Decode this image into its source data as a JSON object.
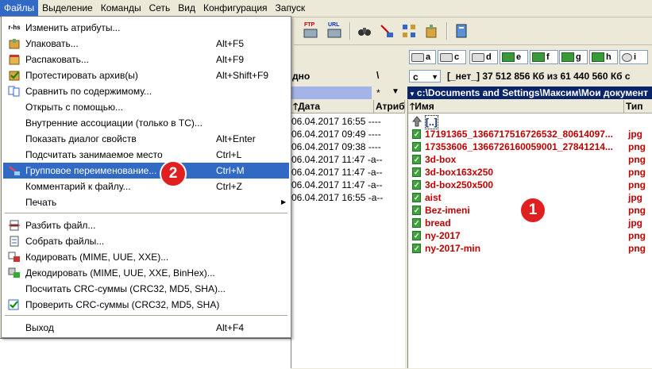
{
  "menubar": {
    "items": [
      "Файлы",
      "Выделение",
      "Команды",
      "Сеть",
      "Вид",
      "Конфигурация",
      "Запуск"
    ]
  },
  "toolbar": {
    "ftp_label": "FTP",
    "url_label": "URL"
  },
  "drives": [
    "a",
    "c",
    "d",
    "e",
    "f",
    "g",
    "h",
    "i"
  ],
  "left_panel": {
    "partial_header": "дно",
    "backslash": "\\",
    "columns": [
      "Дата",
      "Атриб"
    ],
    "rows": [
      {
        "date": "06.04.2017 16:55",
        "attr": "----"
      },
      {
        "date": "06.04.2017 09:49",
        "attr": "----"
      },
      {
        "date": "06.04.2017 09:38",
        "attr": "----"
      },
      {
        "date": "06.04.2017 11:47",
        "attr": "-a--"
      },
      {
        "date": "06.04.2017 11:47",
        "attr": "-a--"
      },
      {
        "date": "06.04.2017 11:47",
        "attr": "-a--"
      },
      {
        "date": "06.04.2017 16:55",
        "attr": "-a--"
      }
    ]
  },
  "right_panel": {
    "drive_select": "c",
    "drive_info": "[_нет_]  37 512 856 Кб из 61 440 560 Кб с",
    "path": "c:\\Documents and Settings\\Максим\\Мои документ",
    "columns": [
      "Имя",
      "Тип"
    ],
    "parent": "[..]",
    "files": [
      {
        "name": "17191365_1366717516726532_80614097...",
        "ext": "jpg"
      },
      {
        "name": "17353606_1366726160059001_27841214...",
        "ext": "png"
      },
      {
        "name": "3d-box",
        "ext": "png"
      },
      {
        "name": "3d-box163x250",
        "ext": "png"
      },
      {
        "name": "3d-box250x500",
        "ext": "png"
      },
      {
        "name": "aist",
        "ext": "jpg"
      },
      {
        "name": "Bez-imeni",
        "ext": "png"
      },
      {
        "name": "bread",
        "ext": "jpg"
      },
      {
        "name": "ny-2017",
        "ext": "png"
      },
      {
        "name": "ny-2017-min",
        "ext": "png"
      }
    ]
  },
  "menu": {
    "items": [
      {
        "label": "Изменить атрибуты...",
        "shortcut": "",
        "icon": "r-hs"
      },
      {
        "label": "Упаковать...",
        "shortcut": "Alt+F5",
        "icon": "pack-icon"
      },
      {
        "label": "Распаковать...",
        "shortcut": "Alt+F9",
        "icon": "unpack-icon"
      },
      {
        "label": "Протестировать архив(ы)",
        "shortcut": "Alt+Shift+F9",
        "icon": "test-icon"
      },
      {
        "label": "Сравнить по содержимому...",
        "shortcut": "",
        "icon": "compare-icon"
      },
      {
        "label": "Открыть с помощью...",
        "shortcut": "",
        "icon": ""
      },
      {
        "label": "Внутренние ассоциации (только в TC)...",
        "shortcut": "",
        "icon": ""
      },
      {
        "label": "Показать диалог свойств",
        "shortcut": "Alt+Enter",
        "icon": ""
      },
      {
        "label": "Подсчитать занимаемое место",
        "shortcut": "Ctrl+L",
        "icon": ""
      },
      {
        "label": "Групповое переименование...",
        "shortcut": "Ctrl+M",
        "icon": "rename-icon"
      },
      {
        "label": "Комментарий к файлу...",
        "shortcut": "Ctrl+Z",
        "icon": ""
      },
      {
        "label": "Печать",
        "shortcut": "",
        "icon": ""
      },
      {
        "label": "Разбить файл...",
        "shortcut": "",
        "icon": "split-icon"
      },
      {
        "label": "Собрать файлы...",
        "shortcut": "",
        "icon": "combine-icon"
      },
      {
        "label": "Кодировать (MIME, UUE, XXE)...",
        "shortcut": "",
        "icon": "encode-icon"
      },
      {
        "label": "Декодировать (MIME, UUE, XXE, BinHex)...",
        "shortcut": "",
        "icon": "decode-icon"
      },
      {
        "label": "Посчитать CRC-суммы (CRC32, MD5, SHA)...",
        "shortcut": "",
        "icon": ""
      },
      {
        "label": "Проверить CRC-суммы (CRC32, MD5, SHA)",
        "shortcut": "",
        "icon": "verify-icon"
      },
      {
        "label": "Выход",
        "shortcut": "Alt+F4",
        "icon": ""
      }
    ]
  },
  "badges": [
    "1",
    "2"
  ],
  "colors": {
    "selection": "#316ac5",
    "file_text": "#c00000",
    "badge": "#e02020"
  }
}
